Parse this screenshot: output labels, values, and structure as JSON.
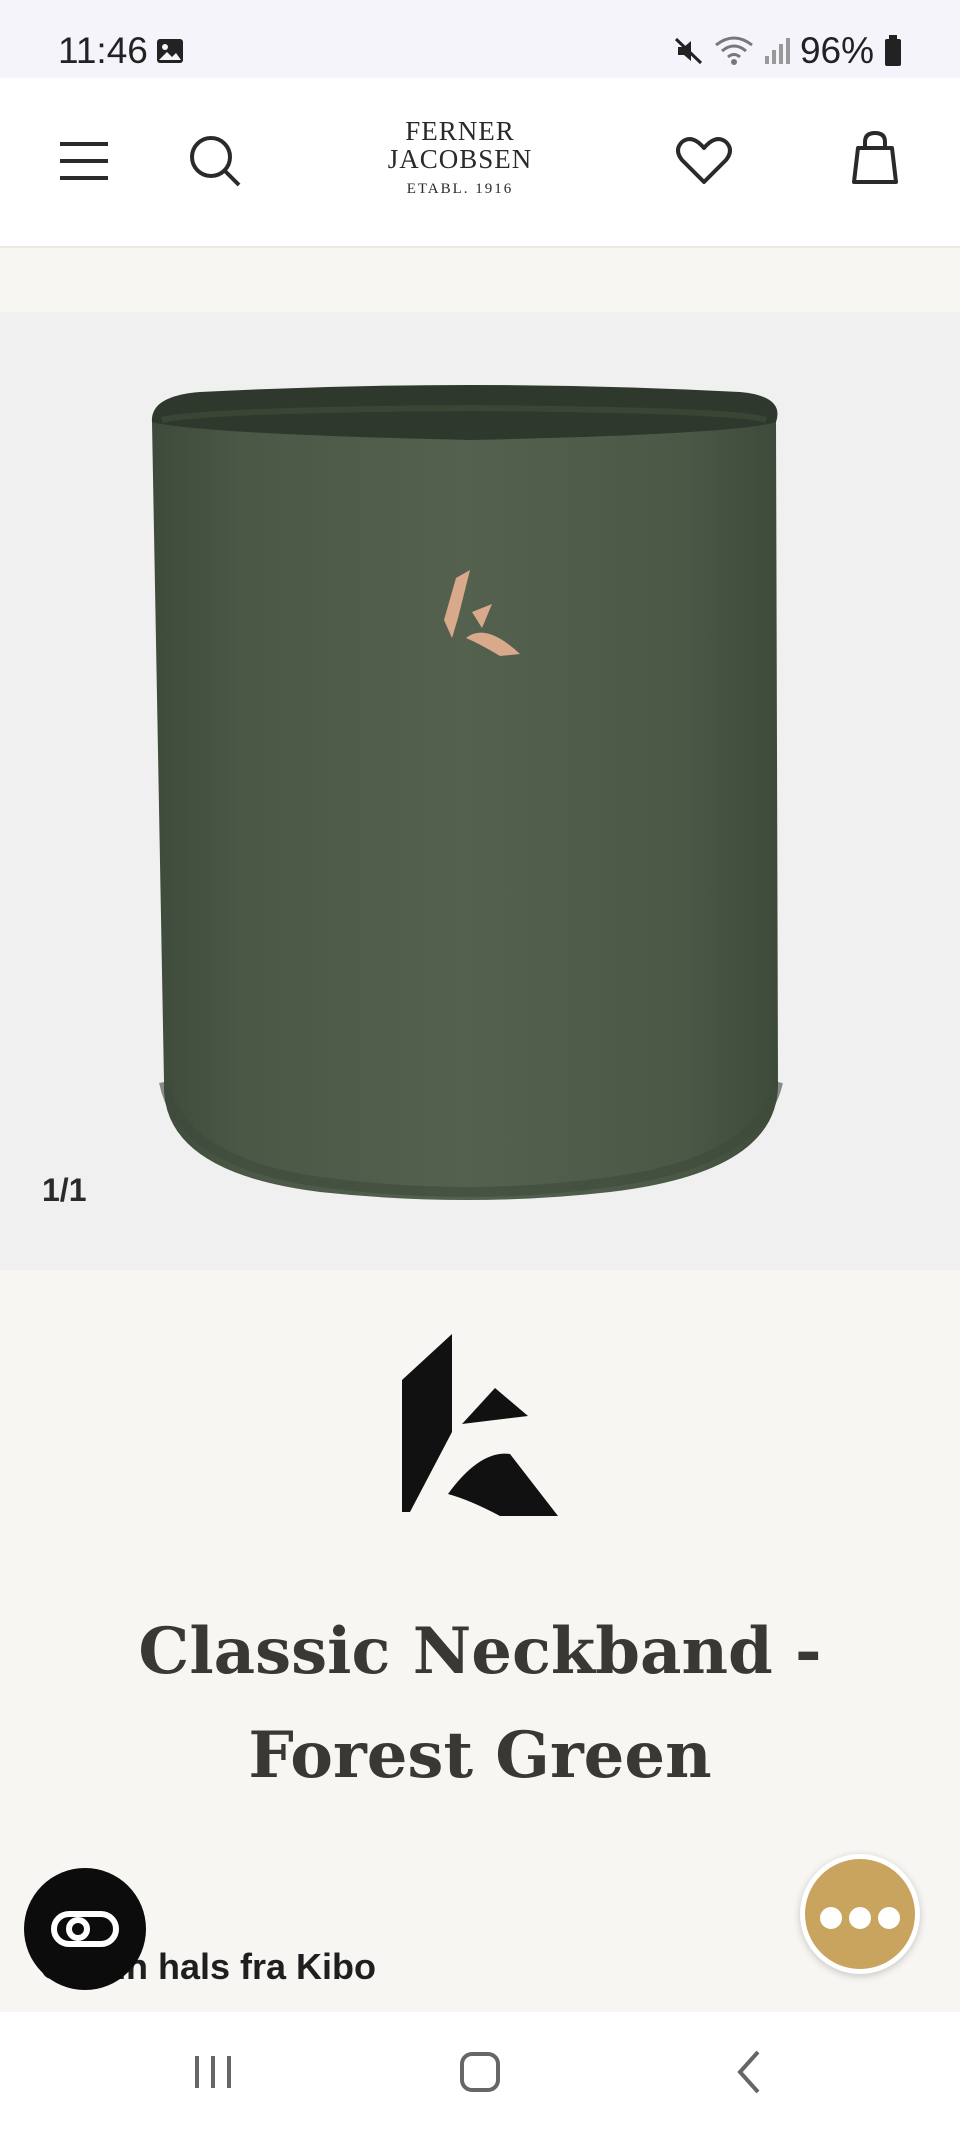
{
  "status_bar": {
    "time": "11:46",
    "battery": "96%",
    "icons": [
      "gallery-icon",
      "mute-icon",
      "wifi-icon",
      "signal-icon",
      "battery-icon"
    ]
  },
  "header": {
    "logo_line1": "FERNER",
    "logo_line2": "JACOBSEN",
    "logo_line3": "ETABL. 1916",
    "icons": [
      "menu-icon",
      "search-icon",
      "heart-icon",
      "bag-icon"
    ]
  },
  "gallery": {
    "counter": "1/1",
    "product_color": "#4a5744"
  },
  "product": {
    "title": "Classic Neckband - Forest Green",
    "subtitle": "Grønn hals fra Kibo"
  },
  "colors": {
    "accent": "#c8a45f",
    "background": "#f7f6f2",
    "gallery_bg": "#f0f0f0"
  },
  "navbar": {
    "icons": [
      "recent-apps-icon",
      "home-icon",
      "back-icon"
    ]
  }
}
